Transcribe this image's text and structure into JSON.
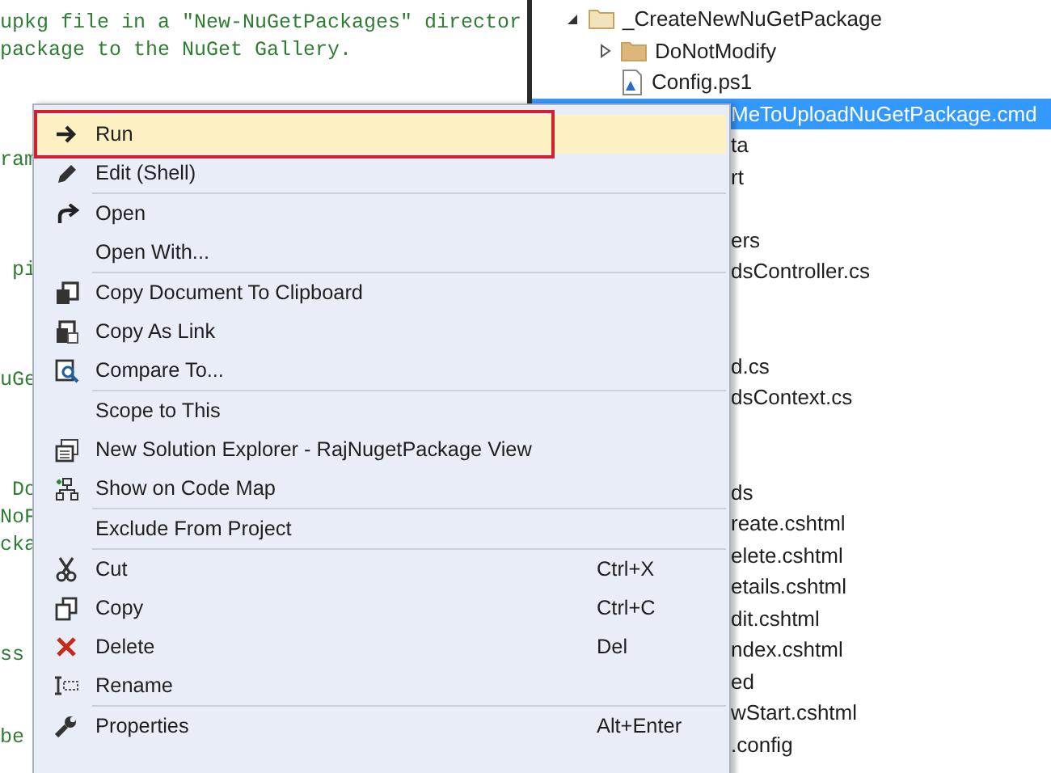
{
  "editor": {
    "lines": [
      {
        "text": "upkg file in a \"New-NuGetPackages\" director"
      },
      {
        "text": "package to the NuGet Gallery."
      },
      {
        "kind": "blank"
      },
      {
        "kind": "blank"
      },
      {
        "kind": "blank"
      },
      {
        "text": "ram"
      },
      {
        "kind": "blank"
      },
      {
        "kind": "blank"
      },
      {
        "kind": "blank"
      },
      {
        "text": " pi"
      },
      {
        "kind": "blank"
      },
      {
        "kind": "blank"
      },
      {
        "kind": "blank"
      },
      {
        "text": "uGe"
      },
      {
        "kind": "blank"
      },
      {
        "kind": "blank"
      },
      {
        "kind": "blank"
      },
      {
        "text": " Do"
      },
      {
        "text": "NoF"
      },
      {
        "text": "cka"
      },
      {
        "kind": "blank"
      },
      {
        "kind": "blank"
      },
      {
        "kind": "blank"
      },
      {
        "text": "ss"
      },
      {
        "kind": "blank"
      },
      {
        "kind": "blank"
      },
      {
        "text": "be"
      }
    ]
  },
  "solution_explorer": {
    "tree": [
      {
        "kind": "folder",
        "text": "_CreateNewNuGetPackage",
        "expanded": true,
        "selected": false,
        "children": [
          {
            "kind": "folder",
            "text": "DoNotModify",
            "expanded": false,
            "selected": false
          },
          {
            "kind": "script",
            "text": "Config.ps1",
            "selected": false
          },
          {
            "kind": "covered",
            "text": "MeToUploadNuGetPackage.cmd",
            "selected": true
          }
        ]
      }
    ],
    "rows_below": [
      {
        "text": "ta"
      },
      {
        "text": "rt"
      },
      {
        "kind": "blank"
      },
      {
        "text": "ers"
      },
      {
        "text": "dsController.cs"
      },
      {
        "kind": "blank"
      },
      {
        "kind": "blank"
      },
      {
        "text": "d.cs"
      },
      {
        "text": "dsContext.cs"
      },
      {
        "kind": "blank"
      },
      {
        "kind": "blank"
      },
      {
        "text": "ds"
      },
      {
        "text": "reate.cshtml"
      },
      {
        "text": "elete.cshtml"
      },
      {
        "text": "etails.cshtml"
      },
      {
        "text": "dit.cshtml"
      },
      {
        "text": "ndex.cshtml"
      },
      {
        "text": "ed"
      },
      {
        "text": "wStart.cshtml"
      },
      {
        "text": ".config"
      }
    ]
  },
  "context_menu": {
    "items": [
      {
        "kind": "item",
        "label": "Run",
        "selected": true,
        "annotated": true
      },
      {
        "kind": "item",
        "label": "Edit (Shell)",
        "selected": false
      },
      {
        "kind": "separator"
      },
      {
        "kind": "item",
        "label": "Open",
        "selected": false
      },
      {
        "kind": "item",
        "label": "Open With...",
        "selected": false
      },
      {
        "kind": "separator"
      },
      {
        "kind": "item",
        "label": "Copy Document To Clipboard",
        "selected": false
      },
      {
        "kind": "item",
        "label": "Copy As Link",
        "selected": false
      },
      {
        "kind": "item",
        "label": "Compare To...",
        "selected": false
      },
      {
        "kind": "separator"
      },
      {
        "kind": "item",
        "label": "Scope to This",
        "selected": false
      },
      {
        "kind": "item",
        "label": "New Solution Explorer - RajNugetPackage View",
        "selected": false
      },
      {
        "kind": "item",
        "label": "Show on Code Map",
        "selected": false
      },
      {
        "kind": "separator"
      },
      {
        "kind": "item",
        "label": "Exclude From Project",
        "selected": false
      },
      {
        "kind": "separator"
      },
      {
        "kind": "item",
        "label": "Cut",
        "shortcut": "Ctrl+X",
        "selected": false
      },
      {
        "kind": "item",
        "label": "Copy",
        "shortcut": "Ctrl+C",
        "selected": false
      },
      {
        "kind": "item",
        "label": "Delete",
        "shortcut": "Del",
        "selected": false
      },
      {
        "kind": "item",
        "label": "Rename",
        "selected": false
      },
      {
        "kind": "separator"
      },
      {
        "kind": "item",
        "label": "Properties",
        "shortcut": "Alt+Enter",
        "selected": false
      }
    ]
  }
}
